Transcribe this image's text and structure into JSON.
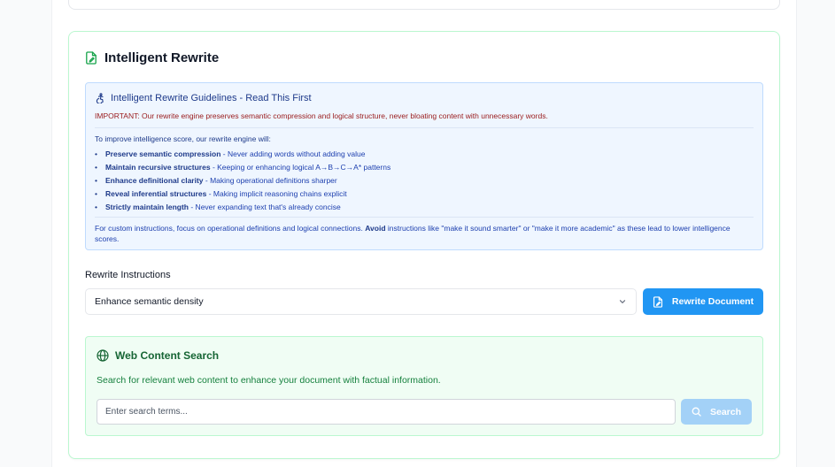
{
  "rewrite_section": {
    "title": "Intelligent Rewrite",
    "icon": "document-pen-icon"
  },
  "guidelines": {
    "icon": "accessibility-icon",
    "title": "Intelligent Rewrite Guidelines - Read This First",
    "important": "IMPORTANT: Our rewrite engine preserves semantic compression and logical structure, never bloating content with unnecessary words.",
    "intro": "To improve intelligence score, our rewrite engine will:",
    "items": [
      {
        "strong": "Preserve semantic compression",
        "rest": " - Never adding words without adding value"
      },
      {
        "strong": "Maintain recursive structures",
        "rest": " - Keeping or enhancing logical A→B→C→A* patterns"
      },
      {
        "strong": "Enhance definitional clarity",
        "rest": " - Making operational definitions sharper"
      },
      {
        "strong": "Reveal inferential structures",
        "rest": " - Making implicit reasoning chains explicit"
      },
      {
        "strong": "Strictly maintain length",
        "rest": " - Never expanding text that's already concise"
      }
    ],
    "footer_pre": "For custom instructions, focus on operational definitions and logical connections. ",
    "footer_bold": "Avoid",
    "footer_post": " instructions like \"make it sound smarter\" or \"make it more academic\" as these lead to lower intelligence scores."
  },
  "instructions": {
    "label": "Rewrite Instructions",
    "selected": "Enhance semantic density",
    "chevron_icon": "chevron-down-icon"
  },
  "rewrite_button": {
    "label": "Rewrite Document",
    "icon": "document-pen-icon",
    "color": "#2196f3"
  },
  "web_search": {
    "icon": "globe-icon",
    "title": "Web Content Search",
    "description": "Search for relevant web content to enhance your document with factual information.",
    "placeholder": "Enter search terms...",
    "button_label": "Search",
    "button_icon": "search-icon",
    "button_color": "#a3d1f7"
  },
  "colors": {
    "accent_green": "#166534",
    "guideline_bg": "#eff6ff",
    "important_red": "#991b1b"
  }
}
